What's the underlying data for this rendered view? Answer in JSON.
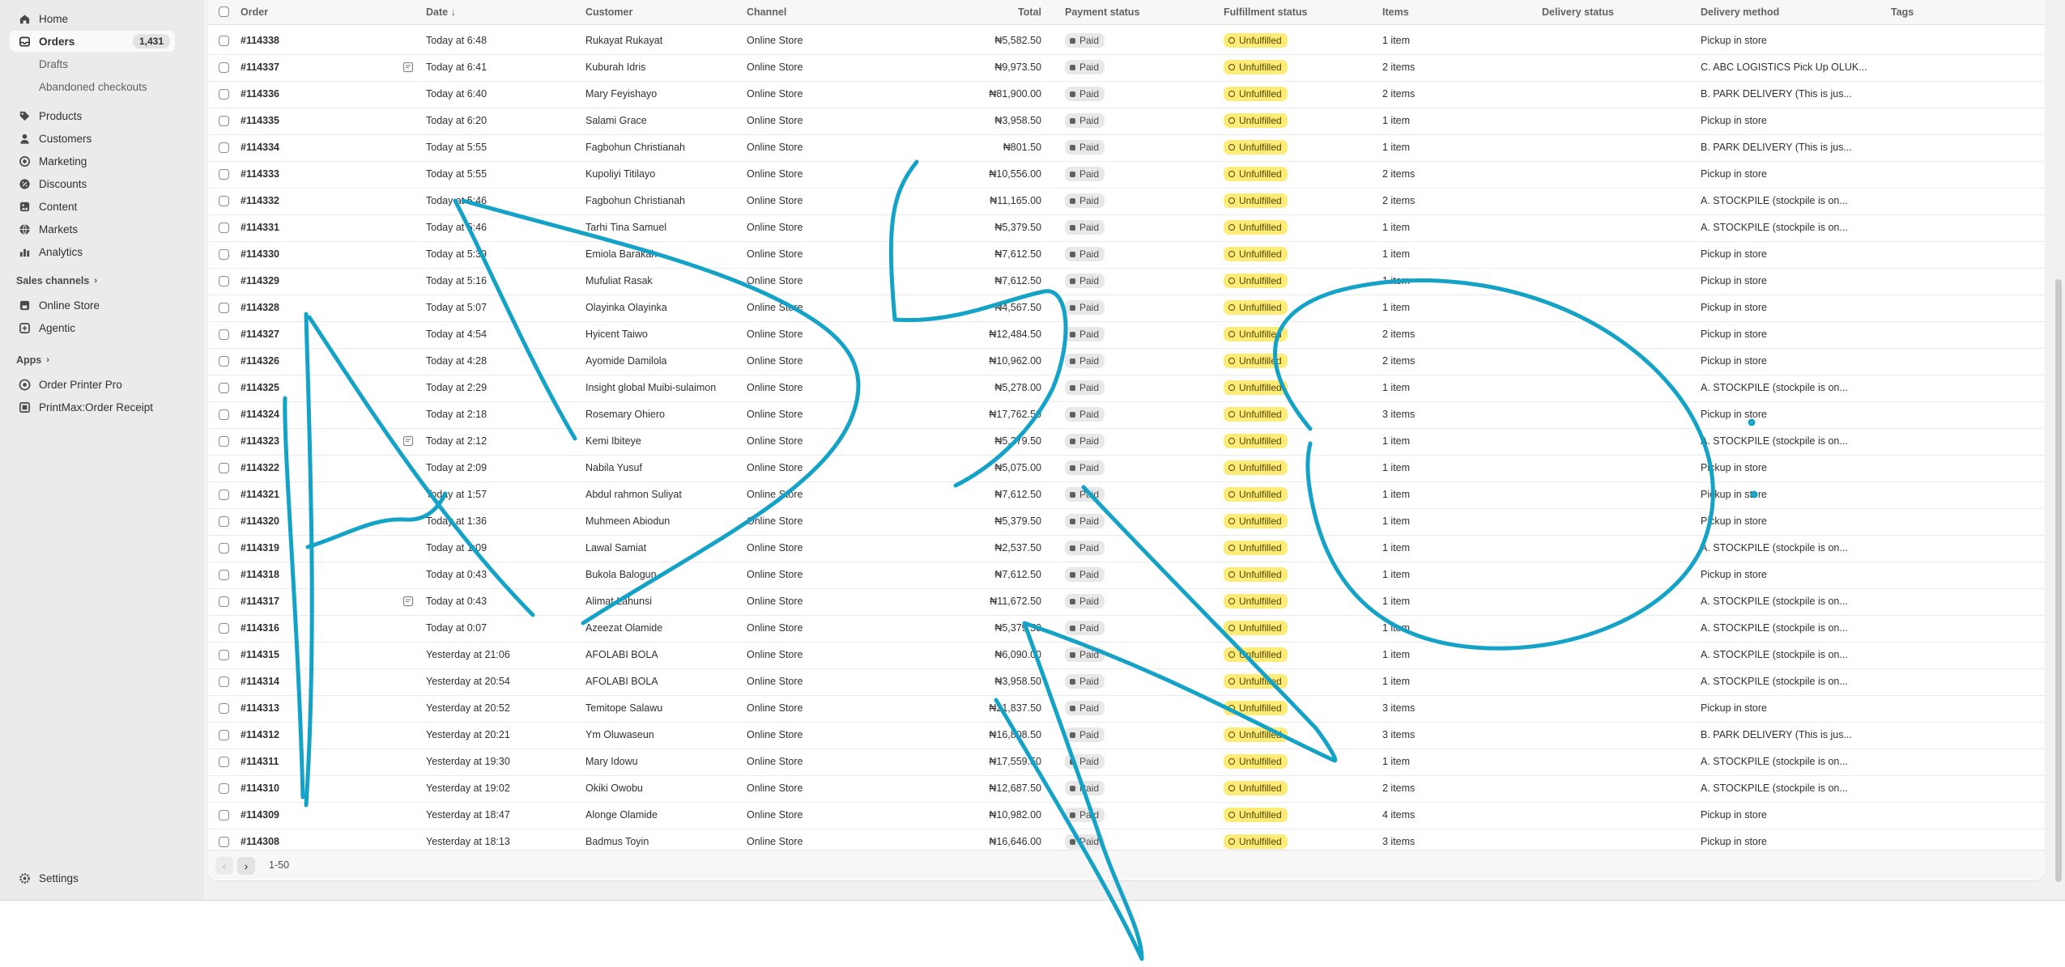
{
  "sidebar": {
    "nav": [
      {
        "label": "Home",
        "icon": "home-icon"
      },
      {
        "label": "Orders",
        "icon": "orders-icon",
        "count": "1,431",
        "active": true
      }
    ],
    "orders_sub": [
      "Drafts",
      "Abandoned checkouts"
    ],
    "nav2": [
      {
        "label": "Products",
        "icon": "tag-icon"
      },
      {
        "label": "Customers",
        "icon": "person-icon"
      },
      {
        "label": "Marketing",
        "icon": "target-icon"
      },
      {
        "label": "Discounts",
        "icon": "discount-icon"
      },
      {
        "label": "Content",
        "icon": "content-icon"
      },
      {
        "label": "Markets",
        "icon": "globe-icon"
      },
      {
        "label": "Analytics",
        "icon": "analytics-icon"
      }
    ],
    "sales_channels_title": "Sales channels",
    "sales_channels": [
      {
        "label": "Online Store",
        "icon": "store-icon"
      },
      {
        "label": "Agentic",
        "icon": "agentic-icon"
      }
    ],
    "apps_title": "Apps",
    "apps": [
      {
        "label": "Order Printer Pro",
        "icon": "printer-app-icon"
      },
      {
        "label": "PrintMax:Order Receipt",
        "icon": "receipt-app-icon"
      }
    ],
    "settings_label": "Settings"
  },
  "table": {
    "headers": {
      "order": "Order",
      "date": "Date ↓",
      "customer": "Customer",
      "channel": "Channel",
      "total": "Total",
      "payment": "Payment status",
      "fulfillment": "Fulfillment status",
      "items": "Items",
      "delivery_status": "Delivery status",
      "delivery_method": "Delivery method",
      "tags": "Tags"
    },
    "rows": [
      {
        "order": "#114338",
        "date": "Today at 6:48",
        "customer": "Rukayat Rukayat",
        "channel": "Online Store",
        "total": "₦5,582.50",
        "payment": "Paid",
        "fulfillment": "Unfulfilled",
        "items": "1 item",
        "method": "Pickup in store",
        "note": false
      },
      {
        "order": "#114337",
        "date": "Today at 6:41",
        "customer": "Kuburah Idris",
        "channel": "Online Store",
        "total": "₦9,973.50",
        "payment": "Paid",
        "fulfillment": "Unfulfilled",
        "items": "2 items",
        "method": "C. ABC LOGISTICS Pick Up OLUK...",
        "note": true
      },
      {
        "order": "#114336",
        "date": "Today at 6:40",
        "customer": "Mary Feyishayo",
        "channel": "Online Store",
        "total": "₦81,900.00",
        "payment": "Paid",
        "fulfillment": "Unfulfilled",
        "items": "2 items",
        "method": "B. PARK DELIVERY (This is jus...",
        "note": false
      },
      {
        "order": "#114335",
        "date": "Today at 6:20",
        "customer": "Salami Grace",
        "channel": "Online Store",
        "total": "₦3,958.50",
        "payment": "Paid",
        "fulfillment": "Unfulfilled",
        "items": "1 item",
        "method": "Pickup in store",
        "note": false
      },
      {
        "order": "#114334",
        "date": "Today at 5:55",
        "customer": "Fagbohun Christianah",
        "channel": "Online Store",
        "total": "₦801.50",
        "payment": "Paid",
        "fulfillment": "Unfulfilled",
        "items": "1 item",
        "method": "B. PARK DELIVERY (This is jus...",
        "note": false
      },
      {
        "order": "#114333",
        "date": "Today at 5:55",
        "customer": "Kupoliyi Titilayo",
        "channel": "Online Store",
        "total": "₦10,556.00",
        "payment": "Paid",
        "fulfillment": "Unfulfilled",
        "items": "2 items",
        "method": "Pickup in store",
        "note": false
      },
      {
        "order": "#114332",
        "date": "Today at 5:46",
        "customer": "Fagbohun Christianah",
        "channel": "Online Store",
        "total": "₦11,165.00",
        "payment": "Paid",
        "fulfillment": "Unfulfilled",
        "items": "2 items",
        "method": "A. STOCKPILE (stockpile is on...",
        "note": false
      },
      {
        "order": "#114331",
        "date": "Today at 5:46",
        "customer": "Tarhi Tina Samuel",
        "channel": "Online Store",
        "total": "₦5,379.50",
        "payment": "Paid",
        "fulfillment": "Unfulfilled",
        "items": "1 item",
        "method": "A. STOCKPILE (stockpile is on...",
        "note": false
      },
      {
        "order": "#114330",
        "date": "Today at 5:39",
        "customer": "Emiola Barakah",
        "channel": "Online Store",
        "total": "₦7,612.50",
        "payment": "Paid",
        "fulfillment": "Unfulfilled",
        "items": "1 item",
        "method": "Pickup in store",
        "note": false
      },
      {
        "order": "#114329",
        "date": "Today at 5:16",
        "customer": "Mufuliat Rasak",
        "channel": "Online Store",
        "total": "₦7,612.50",
        "payment": "Paid",
        "fulfillment": "Unfulfilled",
        "items": "1 item",
        "method": "Pickup in store",
        "note": false
      },
      {
        "order": "#114328",
        "date": "Today at 5:07",
        "customer": "Olayinka Olayinka",
        "channel": "Online Store",
        "total": "₦4,567.50",
        "payment": "Paid",
        "fulfillment": "Unfulfilled",
        "items": "1 item",
        "method": "Pickup in store",
        "note": false
      },
      {
        "order": "#114327",
        "date": "Today at 4:54",
        "customer": "Hyicent Taiwo",
        "channel": "Online Store",
        "total": "₦12,484.50",
        "payment": "Paid",
        "fulfillment": "Unfulfilled",
        "items": "2 items",
        "method": "Pickup in store",
        "note": false
      },
      {
        "order": "#114326",
        "date": "Today at 4:28",
        "customer": "Ayomide Damilola",
        "channel": "Online Store",
        "total": "₦10,962.00",
        "payment": "Paid",
        "fulfillment": "Unfulfilled",
        "items": "2 items",
        "method": "Pickup in store",
        "note": false
      },
      {
        "order": "#114325",
        "date": "Today at 2:29",
        "customer": "Insight global Muibi-sulaimon",
        "channel": "Online Store",
        "total": "₦5,278.00",
        "payment": "Paid",
        "fulfillment": "Unfulfilled",
        "items": "1 item",
        "method": "A. STOCKPILE (stockpile is on...",
        "note": false
      },
      {
        "order": "#114324",
        "date": "Today at 2:18",
        "customer": "Rosemary Ohiero",
        "channel": "Online Store",
        "total": "₦17,762.50",
        "payment": "Paid",
        "fulfillment": "Unfulfilled",
        "items": "3 items",
        "method": "Pickup in store",
        "note": false
      },
      {
        "order": "#114323",
        "date": "Today at 2:12",
        "customer": "Kemi Ibiteye",
        "channel": "Online Store",
        "total": "₦5,279.50",
        "payment": "Paid",
        "fulfillment": "Unfulfilled",
        "items": "1 item",
        "method": "A. STOCKPILE (stockpile is on...",
        "note": true
      },
      {
        "order": "#114322",
        "date": "Today at 2:09",
        "customer": "Nabila Yusuf",
        "channel": "Online Store",
        "total": "₦5,075.00",
        "payment": "Paid",
        "fulfillment": "Unfulfilled",
        "items": "1 item",
        "method": "Pickup in store",
        "note": false
      },
      {
        "order": "#114321",
        "date": "Today at 1:57",
        "customer": "Abdul rahmon Suliyat",
        "channel": "Online Store",
        "total": "₦7,612.50",
        "payment": "Paid",
        "fulfillment": "Unfulfilled",
        "items": "1 item",
        "method": "Pickup in store",
        "note": false
      },
      {
        "order": "#114320",
        "date": "Today at 1:36",
        "customer": "Muhmeen Abiodun",
        "channel": "Online Store",
        "total": "₦5,379.50",
        "payment": "Paid",
        "fulfillment": "Unfulfilled",
        "items": "1 item",
        "method": "Pickup in store",
        "note": false
      },
      {
        "order": "#114319",
        "date": "Today at 1:09",
        "customer": "Lawal Samiat",
        "channel": "Online Store",
        "total": "₦2,537.50",
        "payment": "Paid",
        "fulfillment": "Unfulfilled",
        "items": "1 item",
        "method": "A. STOCKPILE (stockpile is on...",
        "note": false
      },
      {
        "order": "#114318",
        "date": "Today at 0:43",
        "customer": "Bukola Balogun",
        "channel": "Online Store",
        "total": "₦7,612.50",
        "payment": "Paid",
        "fulfillment": "Unfulfilled",
        "items": "1 item",
        "method": "Pickup in store",
        "note": false
      },
      {
        "order": "#114317",
        "date": "Today at 0:43",
        "customer": "Alimat Lahunsi",
        "channel": "Online Store",
        "total": "₦11,672.50",
        "payment": "Paid",
        "fulfillment": "Unfulfilled",
        "items": "1 item",
        "method": "A. STOCKPILE (stockpile is on...",
        "note": true
      },
      {
        "order": "#114316",
        "date": "Today at 0:07",
        "customer": "Azeezat Olamide",
        "channel": "Online Store",
        "total": "₦5,379.50",
        "payment": "Paid",
        "fulfillment": "Unfulfilled",
        "items": "1 item",
        "method": "A. STOCKPILE (stockpile is on...",
        "note": false
      },
      {
        "order": "#114315",
        "date": "Yesterday at 21:06",
        "customer": "AFOLABI BOLA",
        "channel": "Online Store",
        "total": "₦6,090.00",
        "payment": "Paid",
        "fulfillment": "Unfulfilled",
        "items": "1 item",
        "method": "A. STOCKPILE (stockpile is on...",
        "note": false
      },
      {
        "order": "#114314",
        "date": "Yesterday at 20:54",
        "customer": "AFOLABI BOLA",
        "channel": "Online Store",
        "total": "₦3,958.50",
        "payment": "Paid",
        "fulfillment": "Unfulfilled",
        "items": "1 item",
        "method": "A. STOCKPILE (stockpile is on...",
        "note": false
      },
      {
        "order": "#114313",
        "date": "Yesterday at 20:52",
        "customer": "Temitope Salawu",
        "channel": "Online Store",
        "total": "₦21,837.50",
        "payment": "Paid",
        "fulfillment": "Unfulfilled",
        "items": "3 items",
        "method": "Pickup in store",
        "note": false
      },
      {
        "order": "#114312",
        "date": "Yesterday at 20:21",
        "customer": "Ym Oluwaseun",
        "channel": "Online Store",
        "total": "₦16,808.50",
        "payment": "Paid",
        "fulfillment": "Unfulfilled",
        "items": "3 items",
        "method": "B. PARK DELIVERY (This is jus...",
        "note": false
      },
      {
        "order": "#114311",
        "date": "Yesterday at 19:30",
        "customer": "Mary Idowu",
        "channel": "Online Store",
        "total": "₦17,559.50",
        "payment": "Paid",
        "fulfillment": "Unfulfilled",
        "items": "1 item",
        "method": "A. STOCKPILE (stockpile is on...",
        "note": false
      },
      {
        "order": "#114310",
        "date": "Yesterday at 19:02",
        "customer": "Okiki Owobu",
        "channel": "Online Store",
        "total": "₦12,687.50",
        "payment": "Paid",
        "fulfillment": "Unfulfilled",
        "items": "2 items",
        "method": "A. STOCKPILE (stockpile is on...",
        "note": false
      },
      {
        "order": "#114309",
        "date": "Yesterday at 18:47",
        "customer": "Alonge Olamide",
        "channel": "Online Store",
        "total": "₦10,982.00",
        "payment": "Paid",
        "fulfillment": "Unfulfilled",
        "items": "4 items",
        "method": "Pickup in store",
        "note": false
      },
      {
        "order": "#114308",
        "date": "Yesterday at 18:13",
        "customer": "Badmus Toyin",
        "channel": "Online Store",
        "total": "₦16,646.00",
        "payment": "Paid",
        "fulfillment": "Unfulfilled",
        "items": "3 items",
        "method": "Pickup in store",
        "note": false
      }
    ]
  },
  "pagination": {
    "range": "1-50"
  },
  "colors": {
    "annotation_stroke": "#14a3c7",
    "unfulfilled_bg": "#ffeb78",
    "paid_bg": "#e8e8e8"
  }
}
